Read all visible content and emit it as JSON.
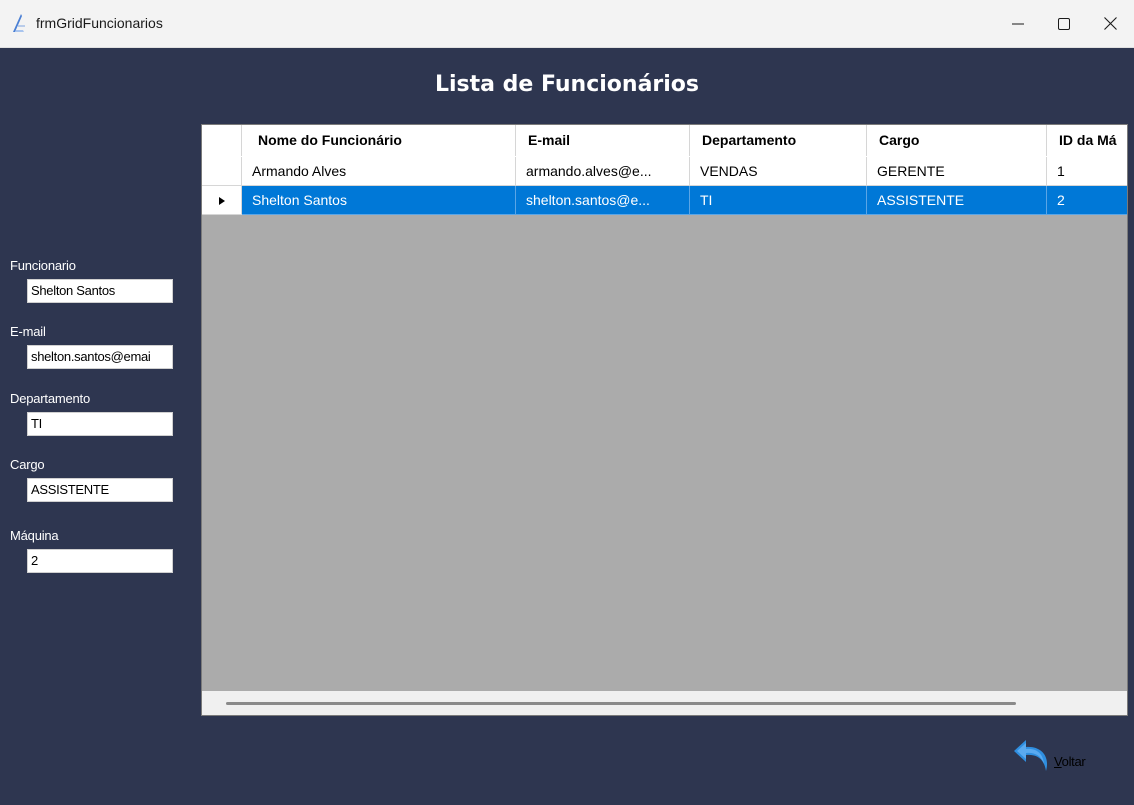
{
  "window": {
    "title": "frmGridFuncionarios",
    "minimize_icon": "minimize-icon",
    "maximize_icon": "maximize-icon",
    "close_icon": "close-icon"
  },
  "heading": "Lista de Funcionários",
  "form": {
    "funcionario_label": "Funcionario",
    "funcionario_value": "Shelton Santos",
    "email_label": "E-mail",
    "email_value": "shelton.santos@emai",
    "departamento_label": "Departamento",
    "departamento_value": "TI",
    "cargo_label": "Cargo",
    "cargo_value": "ASSISTENTE",
    "maquina_label": "Máquina",
    "maquina_value": "2"
  },
  "grid": {
    "columns": [
      "Nome do Funcionário",
      "E-mail",
      "Departamento",
      "Cargo",
      "ID da Má"
    ],
    "rows": [
      {
        "cells": [
          "Armando Alves",
          "armando.alves@e...",
          "VENDAS",
          "GERENTE",
          "1"
        ],
        "selected": false
      },
      {
        "cells": [
          "Shelton Santos",
          "shelton.santos@e...",
          "TI",
          "ASSISTENTE",
          "2"
        ],
        "selected": true
      }
    ],
    "row_indicator_icon": "row-pointer-icon",
    "selection_color": "#0078d7",
    "background_color": "#ababab"
  },
  "back_button": {
    "label": "Voltar",
    "icon": "undo-arrow-icon",
    "accent": "#2f8fe0"
  },
  "colors": {
    "form_background": "#2e3650",
    "titlebar": "#f3f3f3"
  }
}
